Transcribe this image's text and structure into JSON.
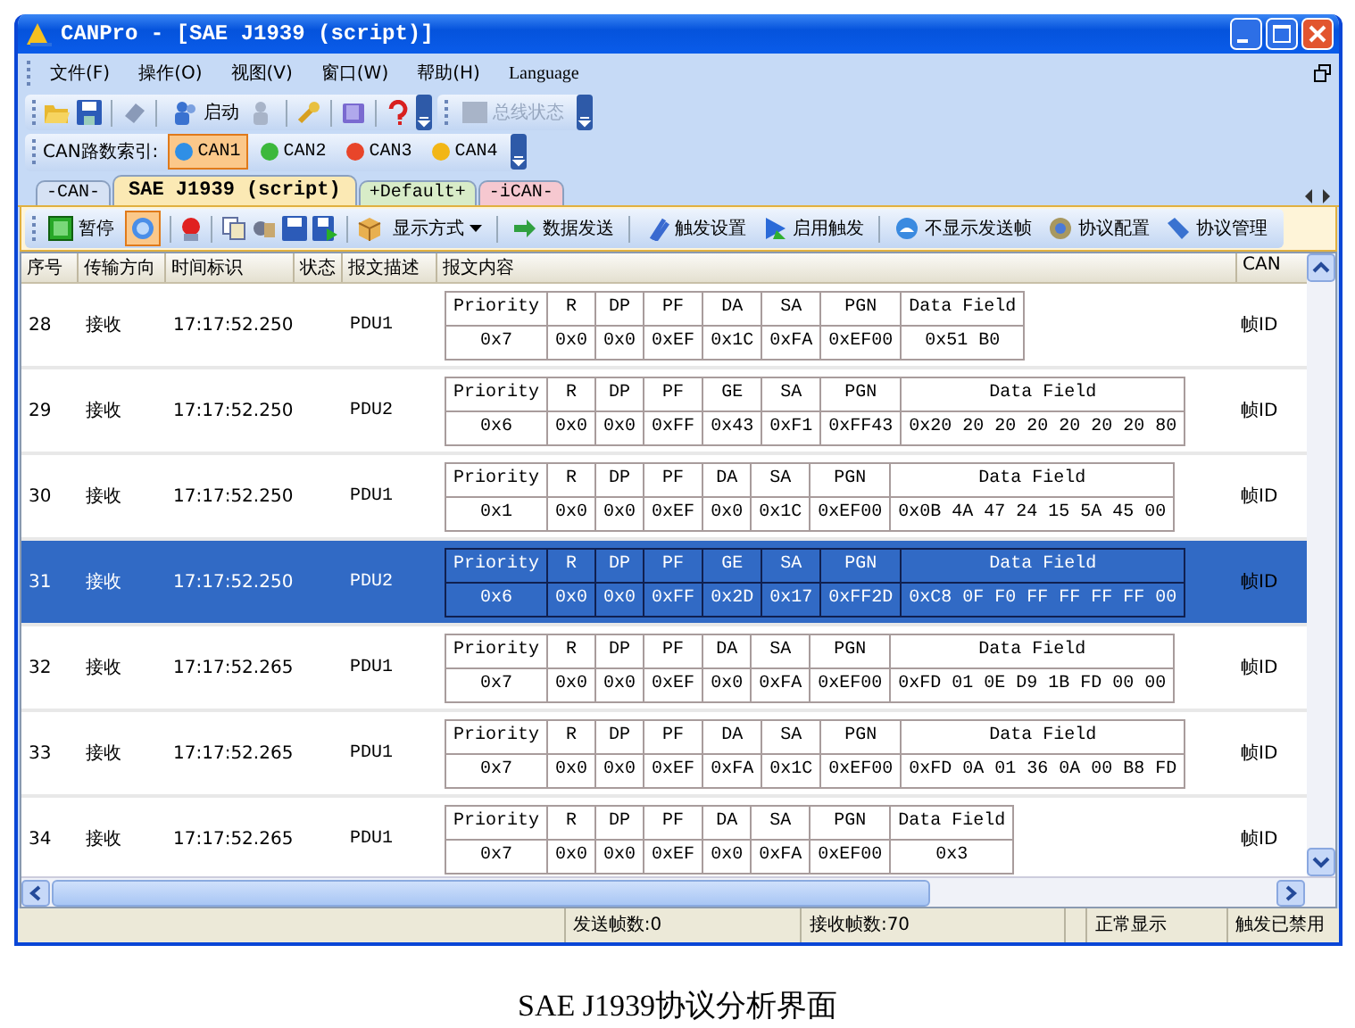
{
  "window": {
    "title": "CANPro - [SAE J1939 (script)]"
  },
  "menu": [
    "文件(F)",
    "操作(O)",
    "视图(V)",
    "窗口(W)",
    "帮助(H)",
    "Language"
  ],
  "main_toolbar": {
    "start_label": "启动",
    "bus_status": {
      "label": "总线状态",
      "disabled": true
    }
  },
  "channel_bar": {
    "label": "CAN路数索引:",
    "channels": [
      {
        "label": "CAN1",
        "selected": true,
        "color": "#2f8fe6"
      },
      {
        "label": "CAN2",
        "selected": false,
        "color": "#3cb83c"
      },
      {
        "label": "CAN3",
        "selected": false,
        "color": "#e8452a"
      },
      {
        "label": "CAN4",
        "selected": false,
        "color": "#f2b616"
      }
    ]
  },
  "tabs": [
    {
      "label": "-CAN-",
      "selected": false,
      "color": "#d6e2f4"
    },
    {
      "label": "SAE J1939 (script)",
      "selected": true,
      "color": "#fbe9b4"
    },
    {
      "label": "+Default+",
      "selected": false,
      "color": "#d8ecc8"
    },
    {
      "label": "-iCAN-",
      "selected": false,
      "color": "#f6c8d0"
    }
  ],
  "action_toolbar": {
    "pause_label": "暂停",
    "view_toggle": {
      "selected": true
    },
    "buttons": [
      {
        "label": "显示方式",
        "kind": "dropdown"
      },
      {
        "label": "数据发送",
        "kind": "button"
      },
      {
        "label": "触发设置",
        "kind": "button"
      },
      {
        "label": "启用触发",
        "kind": "button"
      },
      {
        "label": "不显示发送帧",
        "kind": "button"
      },
      {
        "label": "协议配置",
        "kind": "button"
      },
      {
        "label": "协议管理",
        "kind": "button"
      }
    ]
  },
  "grid": {
    "columns": [
      "序号",
      "传输方向",
      "时间标识",
      "状态",
      "报文描述",
      "报文内容",
      "CAN"
    ],
    "rows": [
      {
        "seq": "28",
        "direction": "接收",
        "time": "17:17:52.250",
        "description": "PDU1",
        "selected": false,
        "frame_id": "帧ID",
        "fields": [
          {
            "name": "Priority",
            "value": "0x7"
          },
          {
            "name": "R",
            "value": "0x0"
          },
          {
            "name": "DP",
            "value": "0x0"
          },
          {
            "name": "PF",
            "value": "0xEF"
          },
          {
            "name": "DA",
            "value": "0x1C"
          },
          {
            "name": "SA",
            "value": "0xFA"
          },
          {
            "name": "PGN",
            "value": "0xEF00"
          },
          {
            "name": "Data Field",
            "value": "0x51 B0"
          }
        ]
      },
      {
        "seq": "29",
        "direction": "接收",
        "time": "17:17:52.250",
        "description": "PDU2",
        "selected": false,
        "frame_id": "帧ID",
        "fields": [
          {
            "name": "Priority",
            "value": "0x6"
          },
          {
            "name": "R",
            "value": "0x0"
          },
          {
            "name": "DP",
            "value": "0x0"
          },
          {
            "name": "PF",
            "value": "0xFF"
          },
          {
            "name": "GE",
            "value": "0x43"
          },
          {
            "name": "SA",
            "value": "0xF1"
          },
          {
            "name": "PGN",
            "value": "0xFF43"
          },
          {
            "name": "Data Field",
            "value": "0x20 20 20 20 20 20 20 80"
          }
        ]
      },
      {
        "seq": "30",
        "direction": "接收",
        "time": "17:17:52.250",
        "description": "PDU1",
        "selected": false,
        "frame_id": "帧ID",
        "fields": [
          {
            "name": "Priority",
            "value": "0x1"
          },
          {
            "name": "R",
            "value": "0x0"
          },
          {
            "name": "DP",
            "value": "0x0"
          },
          {
            "name": "PF",
            "value": "0xEF"
          },
          {
            "name": "DA",
            "value": "0x0"
          },
          {
            "name": "SA",
            "value": "0x1C"
          },
          {
            "name": "PGN",
            "value": "0xEF00"
          },
          {
            "name": "Data Field",
            "value": "0x0B 4A 47 24 15 5A 45 00"
          }
        ]
      },
      {
        "seq": "31",
        "direction": "接收",
        "time": "17:17:52.250",
        "description": "PDU2",
        "selected": true,
        "frame_id": "帧ID",
        "fields": [
          {
            "name": "Priority",
            "value": "0x6"
          },
          {
            "name": "R",
            "value": "0x0"
          },
          {
            "name": "DP",
            "value": "0x0"
          },
          {
            "name": "PF",
            "value": "0xFF"
          },
          {
            "name": "GE",
            "value": "0x2D"
          },
          {
            "name": "SA",
            "value": "0x17"
          },
          {
            "name": "PGN",
            "value": "0xFF2D"
          },
          {
            "name": "Data Field",
            "value": "0xC8 0F F0 FF FF FF FF 00"
          }
        ]
      },
      {
        "seq": "32",
        "direction": "接收",
        "time": "17:17:52.265",
        "description": "PDU1",
        "selected": false,
        "frame_id": "帧ID",
        "fields": [
          {
            "name": "Priority",
            "value": "0x7"
          },
          {
            "name": "R",
            "value": "0x0"
          },
          {
            "name": "DP",
            "value": "0x0"
          },
          {
            "name": "PF",
            "value": "0xEF"
          },
          {
            "name": "DA",
            "value": "0x0"
          },
          {
            "name": "SA",
            "value": "0xFA"
          },
          {
            "name": "PGN",
            "value": "0xEF00"
          },
          {
            "name": "Data Field",
            "value": "0xFD 01 0E D9 1B FD 00 00"
          }
        ]
      },
      {
        "seq": "33",
        "direction": "接收",
        "time": "17:17:52.265",
        "description": "PDU1",
        "selected": false,
        "frame_id": "帧ID",
        "fields": [
          {
            "name": "Priority",
            "value": "0x7"
          },
          {
            "name": "R",
            "value": "0x0"
          },
          {
            "name": "DP",
            "value": "0x0"
          },
          {
            "name": "PF",
            "value": "0xEF"
          },
          {
            "name": "DA",
            "value": "0xFA"
          },
          {
            "name": "SA",
            "value": "0x1C"
          },
          {
            "name": "PGN",
            "value": "0xEF00"
          },
          {
            "name": "Data Field",
            "value": "0xFD 0A 01 36 0A 00 B8 FD"
          }
        ]
      },
      {
        "seq": "34",
        "direction": "接收",
        "time": "17:17:52.265",
        "description": "PDU1",
        "selected": false,
        "frame_id": "帧ID",
        "fields": [
          {
            "name": "Priority",
            "value": "0x7"
          },
          {
            "name": "R",
            "value": "0x0"
          },
          {
            "name": "DP",
            "value": "0x0"
          },
          {
            "name": "PF",
            "value": "0xEF"
          },
          {
            "name": "DA",
            "value": "0x0"
          },
          {
            "name": "SA",
            "value": "0xFA"
          },
          {
            "name": "PGN",
            "value": "0xEF00"
          },
          {
            "name": "Data Field",
            "value": "0x3"
          }
        ]
      }
    ]
  },
  "status_bar": [
    "发送帧数:0",
    "接收帧数:70",
    "正常显示",
    "触发已禁用"
  ],
  "caption": "SAE J1939协议分析界面"
}
